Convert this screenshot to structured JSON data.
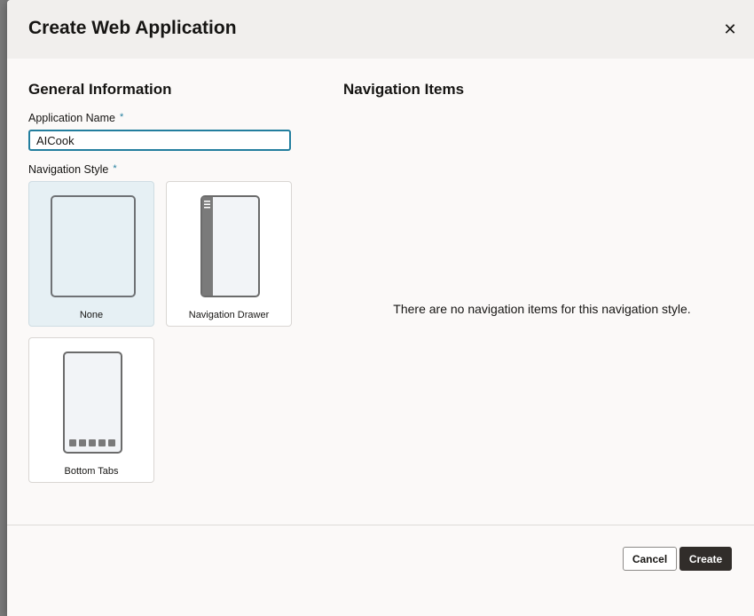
{
  "dialog": {
    "title": "Create Web Application",
    "close_glyph": "✕"
  },
  "general": {
    "heading": "General Information",
    "app_name_label": "Application Name",
    "app_name_value": "AICook",
    "required_marker": "*",
    "nav_style_label": "Navigation Style"
  },
  "nav_styles": [
    {
      "label": "None",
      "selected": true
    },
    {
      "label": "Navigation Drawer",
      "selected": false
    },
    {
      "label": "Bottom Tabs",
      "selected": false
    }
  ],
  "nav_items": {
    "heading": "Navigation Items",
    "empty_message": "There are no navigation items for this navigation style."
  },
  "footer": {
    "cancel_label": "Cancel",
    "create_label": "Create"
  },
  "colors": {
    "accent": "#227e9e",
    "selected_card": "#e6f0f4",
    "primary_button": "#312d2a"
  },
  "icons": [
    "close-icon",
    "hamburger-menu-icon"
  ]
}
